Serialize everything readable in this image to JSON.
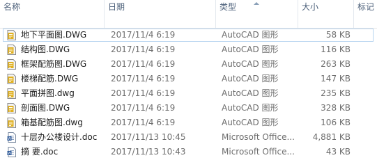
{
  "header": {
    "name": "名称",
    "date": "日期",
    "type": "类型",
    "size": "大小",
    "tags": "标记"
  },
  "colors": {
    "header_text": "#4c607a",
    "row_text": "#1e1e1e",
    "meta_text": "#6d6d6d",
    "selection_border": "#b7d4f0",
    "dwg_icon_color": "#e0b020",
    "doc_icon_color": "#2b5797"
  },
  "files": [
    {
      "name": "地下平面图.DWG",
      "date": "2017/11/4 6:19",
      "type": "AutoCAD 图形",
      "size": "58 KB",
      "icon": "dwg-file-icon",
      "selected": true
    },
    {
      "name": "结构图.DWG",
      "date": "2017/11/4 6:19",
      "type": "AutoCAD 图形",
      "size": "116 KB",
      "icon": "dwg-file-icon",
      "selected": false
    },
    {
      "name": "框架配筋图.DWG",
      "date": "2017/11/4 6:19",
      "type": "AutoCAD 图形",
      "size": "263 KB",
      "icon": "dwg-file-icon",
      "selected": false
    },
    {
      "name": "楼梯配筋.DWG",
      "date": "2017/11/4 6:19",
      "type": "AutoCAD 图形",
      "size": "147 KB",
      "icon": "dwg-file-icon",
      "selected": false
    },
    {
      "name": "平面拼图.dwg",
      "date": "2017/11/4 6:19",
      "type": "AutoCAD 图形",
      "size": "235 KB",
      "icon": "dwg-file-icon",
      "selected": false
    },
    {
      "name": "剖面图.DWG",
      "date": "2017/11/4 6:19",
      "type": "AutoCAD 图形",
      "size": "328 KB",
      "icon": "dwg-file-icon",
      "selected": false
    },
    {
      "name": "箱基配筋图.dwg",
      "date": "2017/11/4 6:19",
      "type": "AutoCAD 图形",
      "size": "106 KB",
      "icon": "dwg-file-icon",
      "selected": false
    },
    {
      "name": "十层办公楼设计.doc",
      "date": "2017/11/13 10:45",
      "type": "Microsoft Office...",
      "size": "4,881 KB",
      "icon": "word-doc-icon",
      "selected": false
    },
    {
      "name": "摘 要.doc",
      "date": "2017/11/13 10:43",
      "type": "Microsoft Office...",
      "size": "43 KB",
      "icon": "word-doc-icon",
      "selected": false
    }
  ]
}
